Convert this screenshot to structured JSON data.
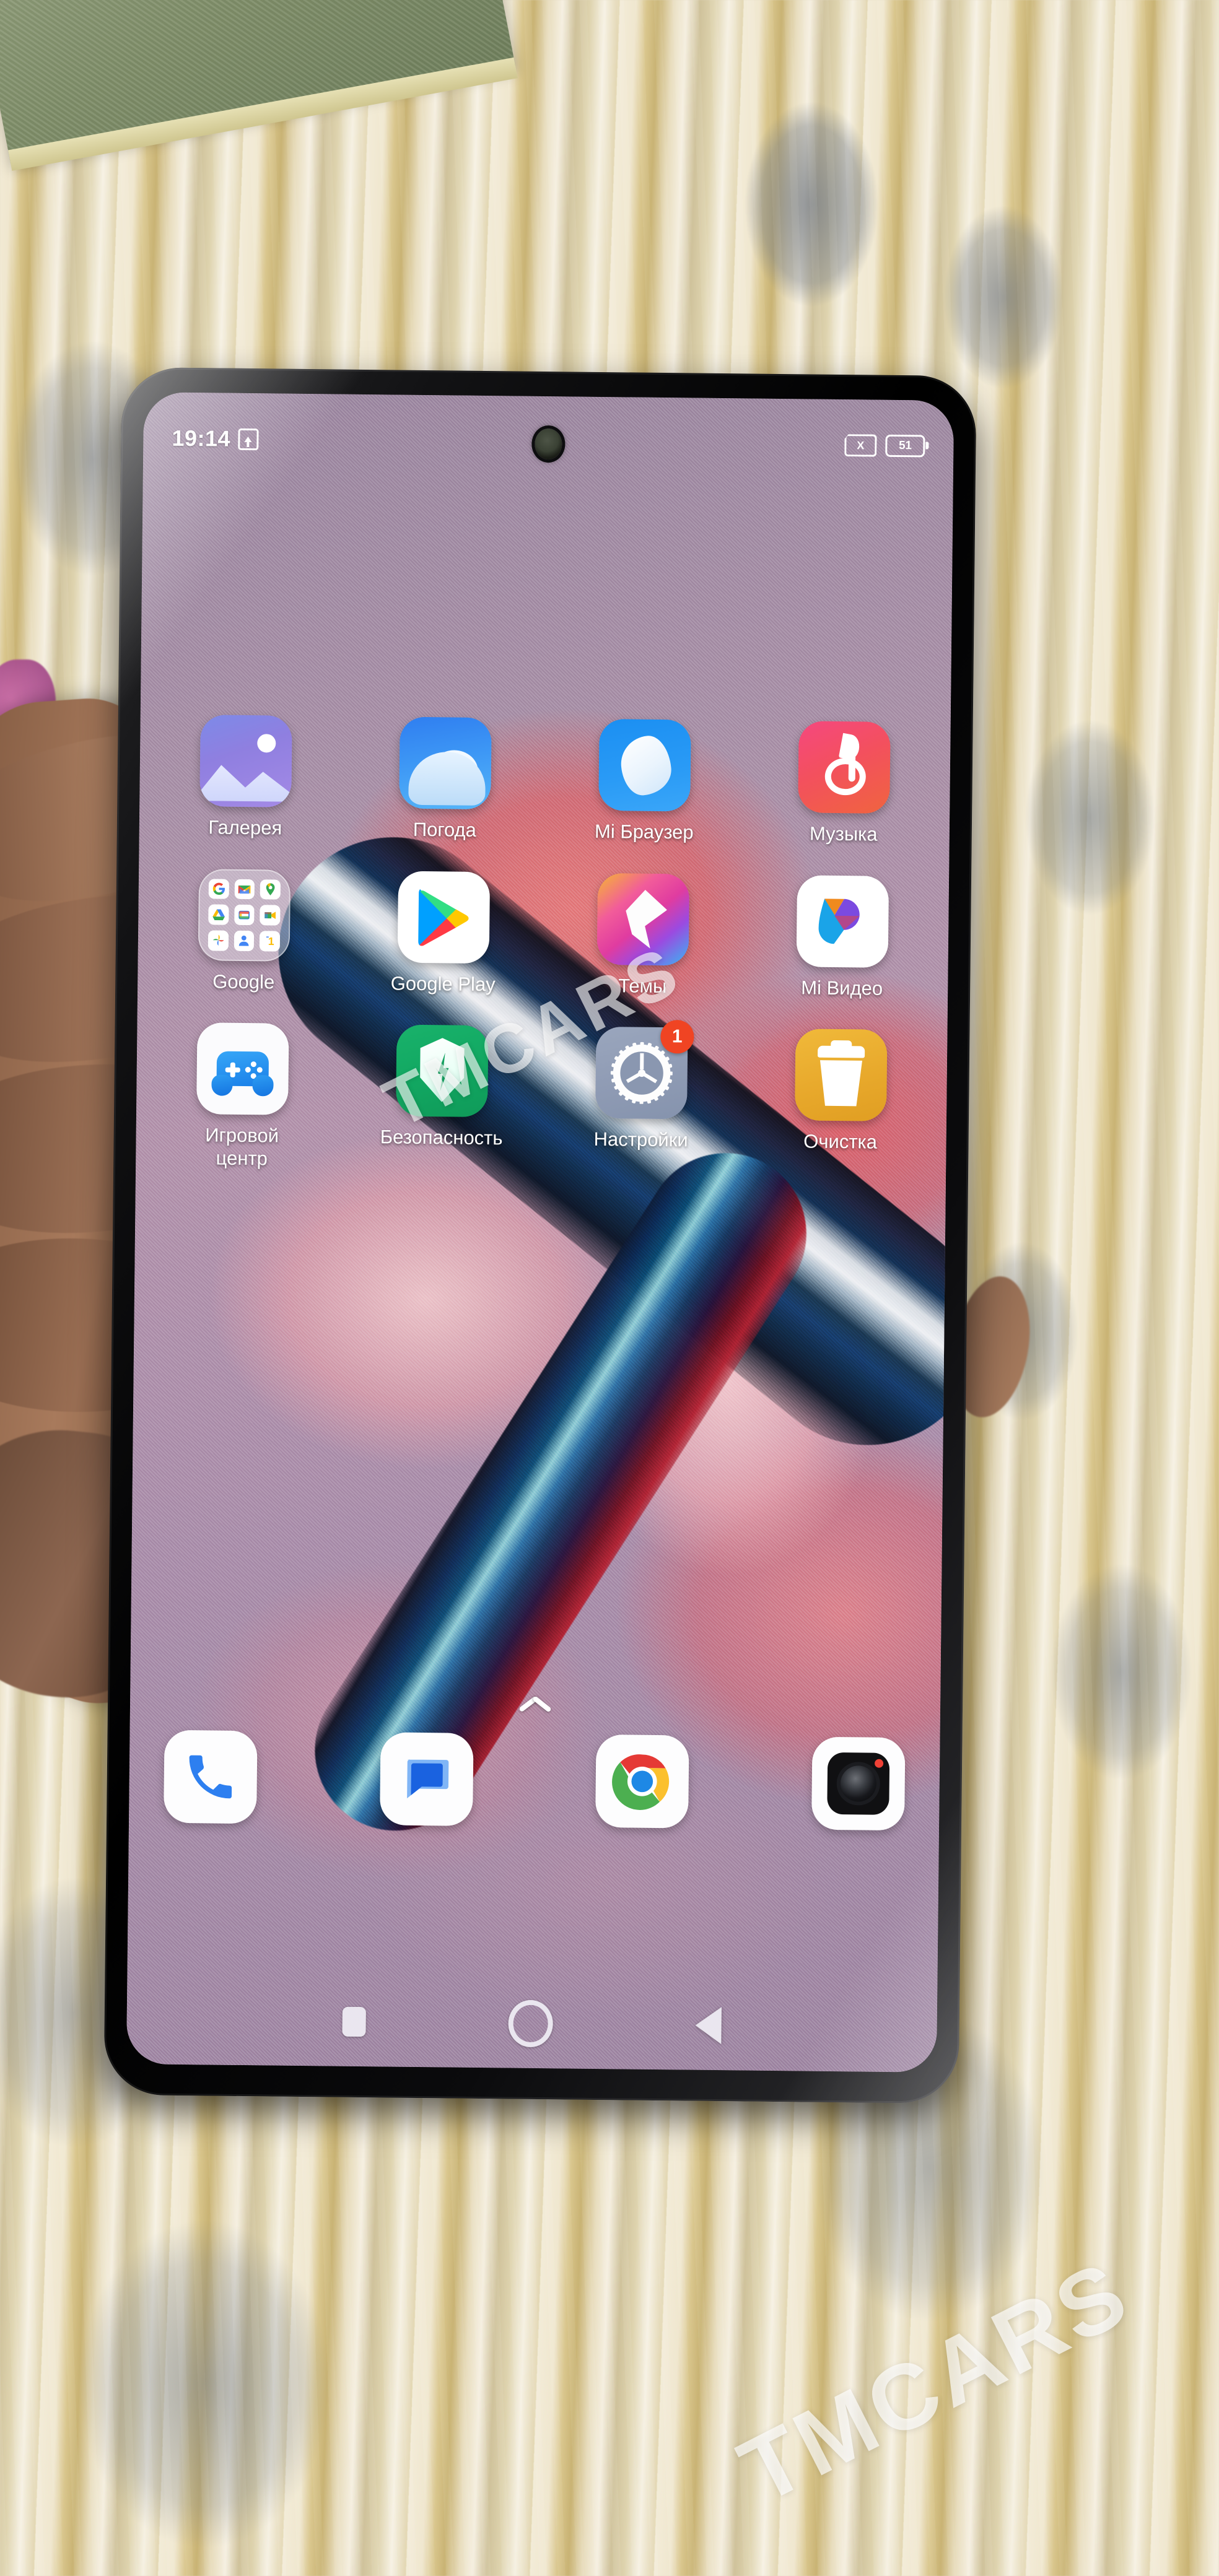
{
  "scene": {
    "description": "hand holding android phone over patterned carpet",
    "watermarks": [
      "TMCARS",
      "TMCARS"
    ]
  },
  "status_bar": {
    "time": "19:14",
    "upload_icon": "upload-arrow-icon",
    "sim_icon": "sim-card-no-signal-icon",
    "sim_label": "X",
    "battery_icon": "battery-icon",
    "battery_percent": "51"
  },
  "home_screen": {
    "rows": [
      {
        "apps": [
          {
            "label": "Галерея",
            "icon": "gallery-icon"
          },
          {
            "label": "Погода",
            "icon": "weather-icon"
          },
          {
            "label": "Mi Браузер",
            "icon": "mi-browser-icon"
          },
          {
            "label": "Музыка",
            "icon": "music-icon"
          }
        ]
      },
      {
        "apps": [
          {
            "label": "Google",
            "icon": "google-folder-icon"
          },
          {
            "label": "Google Play",
            "icon": "google-play-icon"
          },
          {
            "label": "Темы",
            "icon": "themes-icon"
          },
          {
            "label": "Mi Видео",
            "icon": "mi-video-icon"
          }
        ]
      },
      {
        "apps": [
          {
            "label": "Игровой\nцентр",
            "icon": "game-center-icon"
          },
          {
            "label": "Безопасность",
            "icon": "security-icon"
          },
          {
            "label": "Настройки",
            "icon": "settings-icon",
            "badge": "1"
          },
          {
            "label": "Очистка",
            "icon": "cleaner-icon"
          }
        ]
      }
    ],
    "google_folder_apps": [
      "Google",
      "Gmail",
      "Maps",
      "Drive",
      "Photos",
      "Meet",
      "Google Photos",
      "Contacts",
      "Google One"
    ],
    "app_drawer_indicator": "chevron-up-icon"
  },
  "dock": {
    "apps": [
      {
        "label": "Phone",
        "icon": "phone-icon"
      },
      {
        "label": "Messages",
        "icon": "messages-icon"
      },
      {
        "label": "Chrome",
        "icon": "chrome-icon"
      },
      {
        "label": "Camera",
        "icon": "camera-icon"
      }
    ]
  },
  "nav_bar": {
    "recents": "square-recents-icon",
    "home": "circle-home-icon",
    "back": "triangle-back-icon"
  },
  "colors": {
    "accent_pink": "#f5487f",
    "accent_blue": "#2f7ef0",
    "accent_green": "#19b26b",
    "accent_amber": "#f0b93a",
    "badge_red": "#f04423",
    "wallpaper_base": "#a78fa6"
  }
}
